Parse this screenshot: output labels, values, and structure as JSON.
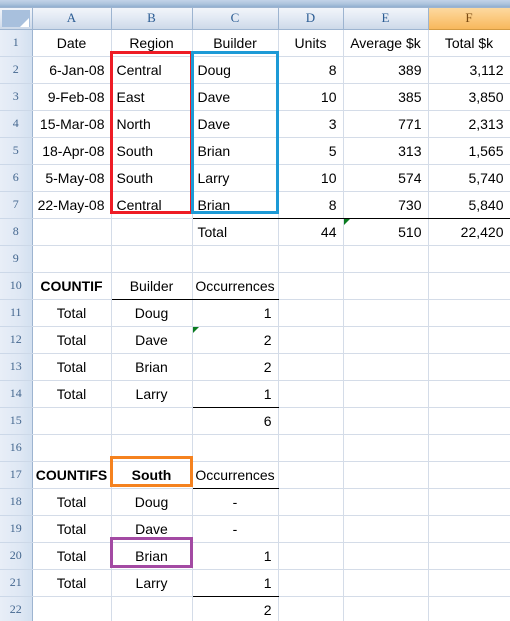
{
  "app": {
    "name": "spreadsheet",
    "select_all_label": "Select All"
  },
  "columns": [
    {
      "id": "A",
      "label": "A",
      "selected": false
    },
    {
      "id": "B",
      "label": "B",
      "selected": false
    },
    {
      "id": "C",
      "label": "C",
      "selected": false
    },
    {
      "id": "D",
      "label": "D",
      "selected": false
    },
    {
      "id": "E",
      "label": "E",
      "selected": false
    },
    {
      "id": "F",
      "label": "F",
      "selected": true
    }
  ],
  "row_headers": [
    "1",
    "2",
    "3",
    "4",
    "5",
    "6",
    "7",
    "8",
    "9",
    "10",
    "11",
    "12",
    "13",
    "14",
    "15",
    "16",
    "17",
    "18",
    "19",
    "20",
    "21",
    "22"
  ],
  "cells": {
    "A1": "Date",
    "B1": "Region",
    "C1": "Builder",
    "D1": "Units",
    "E1": "Average $k",
    "F1": "Total $k",
    "A2": "6-Jan-08",
    "B2": "Central",
    "C2": "Doug",
    "D2": "8",
    "E2": "389",
    "F2": "3,112",
    "A3": "9-Feb-08",
    "B3": "East",
    "C3": "Dave",
    "D3": "10",
    "E3": "385",
    "F3": "3,850",
    "A4": "15-Mar-08",
    "B4": "North",
    "C4": "Dave",
    "D4": "3",
    "E4": "771",
    "F4": "2,313",
    "A5": "18-Apr-08",
    "B5": "South",
    "C5": "Brian",
    "D5": "5",
    "E5": "313",
    "F5": "1,565",
    "A6": "5-May-08",
    "B6": "South",
    "C6": "Larry",
    "D6": "10",
    "E6": "574",
    "F6": "5,740",
    "A7": "22-May-08",
    "B7": "Central",
    "C7": "Brian",
    "D7": "8",
    "E7": "730",
    "F7": "5,840",
    "A8": "",
    "B8": "",
    "C8": "Total",
    "D8": "44",
    "E8": "510",
    "F8": "22,420",
    "A9": "",
    "B9": "",
    "C9": "",
    "D9": "",
    "E9": "",
    "F9": "",
    "A10": "COUNTIF",
    "B10": "Builder",
    "C10": "Occurrences",
    "D10": "",
    "E10": "",
    "F10": "",
    "A11": "Total",
    "B11": "Doug",
    "C11": "1",
    "D11": "",
    "E11": "",
    "F11": "",
    "A12": "Total",
    "B12": "Dave",
    "C12": "2",
    "D12": "",
    "E12": "",
    "F12": "",
    "A13": "Total",
    "B13": "Brian",
    "C13": "2",
    "D13": "",
    "E13": "",
    "F13": "",
    "A14": "Total",
    "B14": "Larry",
    "C14": "1",
    "D14": "",
    "E14": "",
    "F14": "",
    "A15": "",
    "B15": "",
    "C15": "6",
    "D15": "",
    "E15": "",
    "F15": "",
    "A16": "",
    "B16": "",
    "C16": "",
    "D16": "",
    "E16": "",
    "F16": "",
    "A17": "COUNTIFS",
    "B17": "South",
    "C17": "Occurrences",
    "D17": "",
    "E17": "",
    "F17": "",
    "A18": "Total",
    "B18": "Doug",
    "C18": "-",
    "D18": "",
    "E18": "",
    "F18": "",
    "A19": "Total",
    "B19": "Dave",
    "C19": "-",
    "D19": "",
    "E19": "",
    "F19": "",
    "A20": "Total",
    "B20": "Brian",
    "C20": "1",
    "D20": "",
    "E20": "",
    "F20": "",
    "A21": "Total",
    "B21": "Larry",
    "C21": "1",
    "D21": "",
    "E21": "",
    "F21": "",
    "A22": "",
    "B22": "",
    "C22": "2",
    "D22": "",
    "E22": "",
    "F22": ""
  },
  "annotations": [
    {
      "name": "region-range-outline",
      "color": "#ee1c25",
      "range": "B2:B7",
      "style": "red"
    },
    {
      "name": "builder-range-outline",
      "color": "#1d9ad6",
      "range": "C2:C7",
      "style": "blue"
    },
    {
      "name": "criteria-south-outline",
      "color": "#f5821f",
      "range": "B17",
      "style": "orange"
    },
    {
      "name": "criteria-brian-outline",
      "color": "#a34aa3",
      "range": "B20",
      "style": "purple"
    }
  ],
  "error_flags": [
    {
      "cell": "E8",
      "name": "formula-error-flag-e8"
    },
    {
      "cell": "C12",
      "name": "formula-error-flag-c12"
    }
  ]
}
